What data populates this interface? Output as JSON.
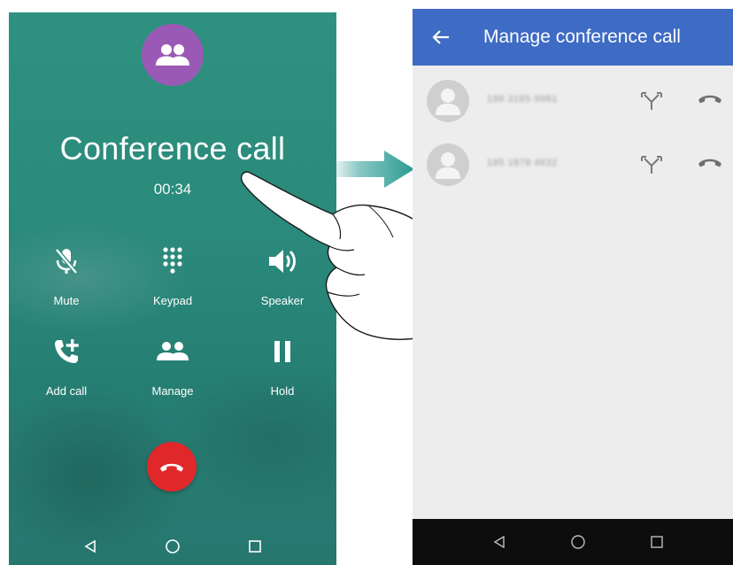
{
  "left_screen": {
    "title": "Conference call",
    "timer": "00:34",
    "controls": [
      {
        "label": "Mute",
        "icon": "mic-off-icon"
      },
      {
        "label": "Keypad",
        "icon": "dialpad-icon"
      },
      {
        "label": "Speaker",
        "icon": "speaker-icon"
      },
      {
        "label": "Add call",
        "icon": "add-call-icon"
      },
      {
        "label": "Manage",
        "icon": "people-icon"
      },
      {
        "label": "Hold",
        "icon": "pause-icon"
      }
    ],
    "end_call_icon": "hang-up-icon",
    "navbar": [
      "back-icon",
      "home-icon",
      "recents-icon"
    ],
    "colors": {
      "background": "#2a8a7b",
      "avatar": "#9b59b6",
      "end_call": "#e0282b"
    }
  },
  "right_screen": {
    "title": "Manage conference call",
    "participants": [
      {
        "number": "188 3165 9981",
        "split_icon": "split-call-icon",
        "hangup_icon": "hang-up-icon"
      },
      {
        "number": "185 1878 4632",
        "split_icon": "split-call-icon",
        "hangup_icon": "hang-up-icon"
      }
    ],
    "navbar": [
      "back-icon",
      "home-icon",
      "recents-icon"
    ],
    "colors": {
      "app_bar": "#3e6bc4",
      "background": "#ededed",
      "navbar": "#0d0d0d"
    }
  }
}
